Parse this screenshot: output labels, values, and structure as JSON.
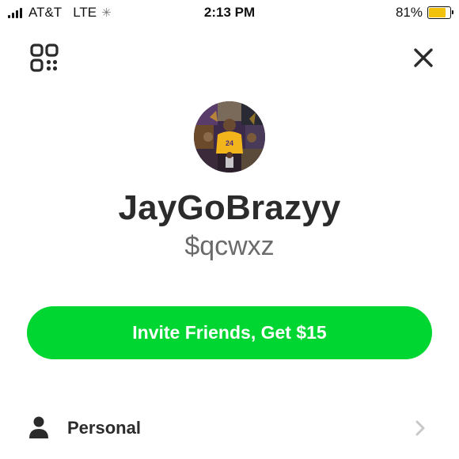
{
  "status_bar": {
    "carrier": "AT&T",
    "network": "LTE",
    "time": "2:13 PM",
    "battery_percent_label": "81%",
    "battery_level": 0.81,
    "battery_color": "#f2c20a"
  },
  "header": {
    "qr_icon": "qr-code-icon",
    "close_icon": "close-icon"
  },
  "profile": {
    "display_name": "JayGoBrazyy",
    "cashtag": "$qcwxz",
    "avatar": "profile-avatar-photo"
  },
  "invite": {
    "label": "Invite Friends, Get $15",
    "color": "#00d632"
  },
  "menu": {
    "items": [
      {
        "label": "Personal",
        "icon": "person-icon"
      }
    ]
  }
}
